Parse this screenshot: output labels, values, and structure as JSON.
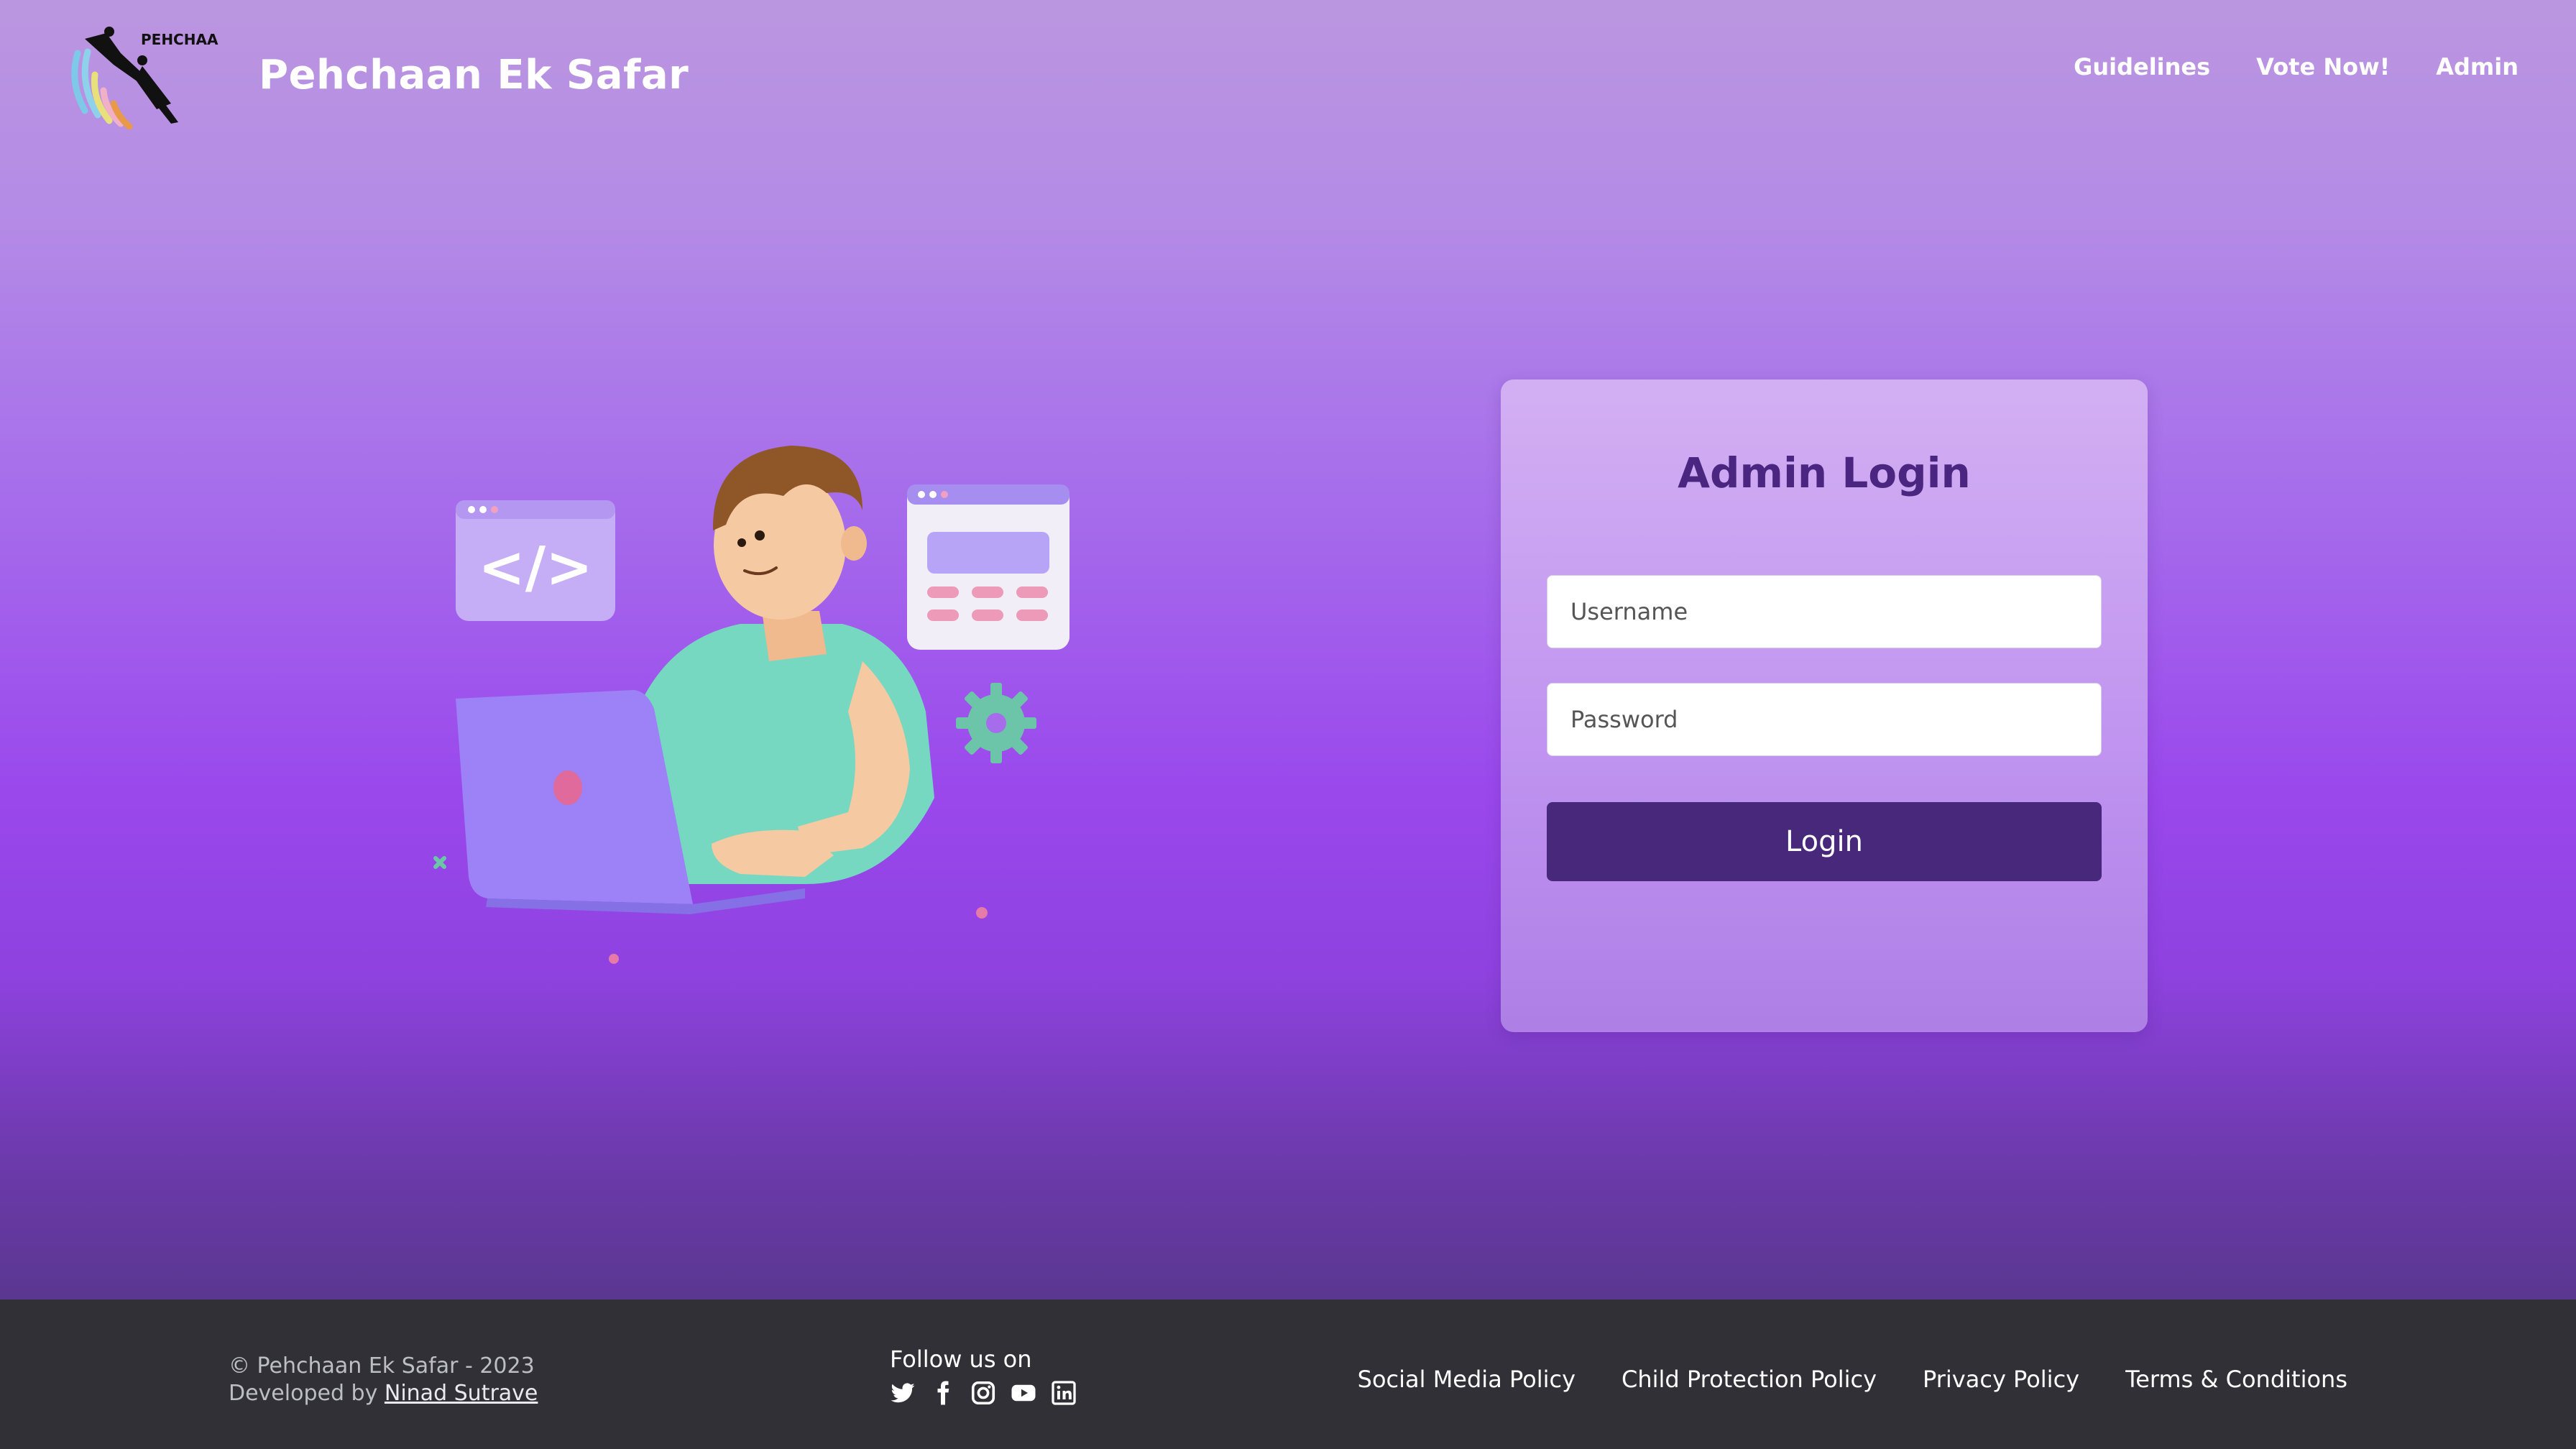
{
  "header": {
    "logo_text": "PEHCHAAN",
    "brand": "Pehchaan Ek Safar",
    "nav": [
      {
        "label": "Guidelines"
      },
      {
        "label": "Vote Now!"
      },
      {
        "label": "Admin"
      }
    ]
  },
  "login": {
    "title": "Admin Login",
    "username_placeholder": "Username",
    "password_placeholder": "Password",
    "button_label": "Login"
  },
  "footer": {
    "copyright": "© Pehchaan Ek Safar - 2023",
    "developed_by": "Developed by",
    "developer": "Ninad Sutrave",
    "follow_label": "Follow us on",
    "social_icons": [
      "twitter-icon",
      "facebook-icon",
      "instagram-icon",
      "youtube-icon",
      "linkedin-icon"
    ],
    "links": [
      {
        "label": "Social Media Policy"
      },
      {
        "label": "Child Protection Policy"
      },
      {
        "label": "Privacy Policy"
      },
      {
        "label": "Terms & Conditions"
      }
    ]
  },
  "colors": {
    "accent_dark": "#48287a",
    "title": "#4a2680",
    "footer_bg": "#303036"
  }
}
